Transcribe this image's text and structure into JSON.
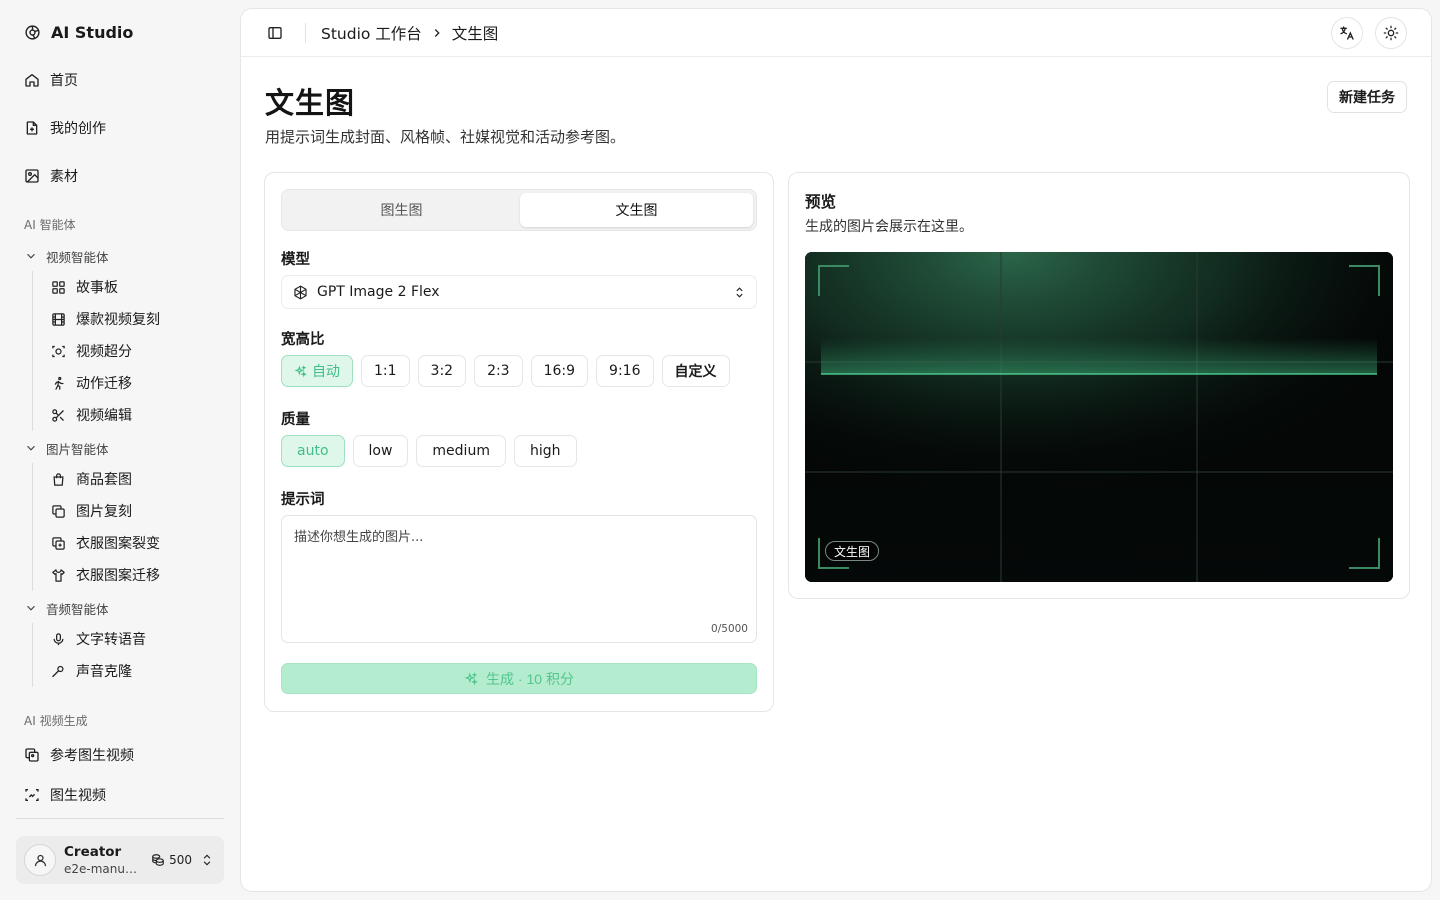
{
  "app": {
    "name": "AI Studio"
  },
  "sidebar": {
    "main_items": [
      {
        "label": "首页",
        "icon": "home-icon"
      },
      {
        "label": "我的创作",
        "icon": "file-icon"
      },
      {
        "label": "素材",
        "icon": "image-icon"
      }
    ],
    "section_ai_agent": "AI 智能体",
    "video_group": {
      "label": "视频智能体",
      "items": [
        "故事板",
        "爆款视频复刻",
        "视频超分",
        "动作迁移",
        "视频编辑"
      ]
    },
    "image_group": {
      "label": "图片智能体",
      "items": [
        "商品套图",
        "图片复刻",
        "衣服图案裂变",
        "衣服图案迁移"
      ]
    },
    "audio_group": {
      "label": "音频智能体",
      "items": [
        "文字转语音",
        "声音克隆"
      ]
    },
    "section_ai_video": "AI 视频生成",
    "video_gen_items": [
      "参考图生视频",
      "图生视频"
    ],
    "user": {
      "name": "Creator",
      "email": "e2e-manua...",
      "credits": "500"
    }
  },
  "header": {
    "breadcrumb_root": "Studio 工作台",
    "breadcrumb_current": "文生图"
  },
  "page": {
    "title": "文生图",
    "subtitle": "用提示词生成封面、风格帧、社媒视觉和活动参考图。",
    "new_task_label": "新建任务"
  },
  "form": {
    "tabs": [
      {
        "label": "图生图",
        "active": false
      },
      {
        "label": "文生图",
        "active": true
      }
    ],
    "model_label": "模型",
    "model_value": "GPT Image 2 Flex",
    "aspect_label": "宽高比",
    "aspect_options": [
      "自动",
      "1:1",
      "3:2",
      "2:3",
      "16:9",
      "9:16",
      "自定义"
    ],
    "aspect_selected": "自动",
    "quality_label": "质量",
    "quality_options": [
      "auto",
      "low",
      "medium",
      "high"
    ],
    "quality_selected": "auto",
    "prompt_label": "提示词",
    "prompt_placeholder": "描述你想生成的图片...",
    "prompt_value": "",
    "prompt_counter": "0/5000",
    "generate_label": "生成 · 10 积分"
  },
  "preview": {
    "title": "预览",
    "subtitle": "生成的图片会展示在这里。",
    "tag": "文生图"
  },
  "colors": {
    "accent": "#3fbf85",
    "accent_light": "#dff6ea",
    "button_disabled": "#b4ecd0"
  }
}
